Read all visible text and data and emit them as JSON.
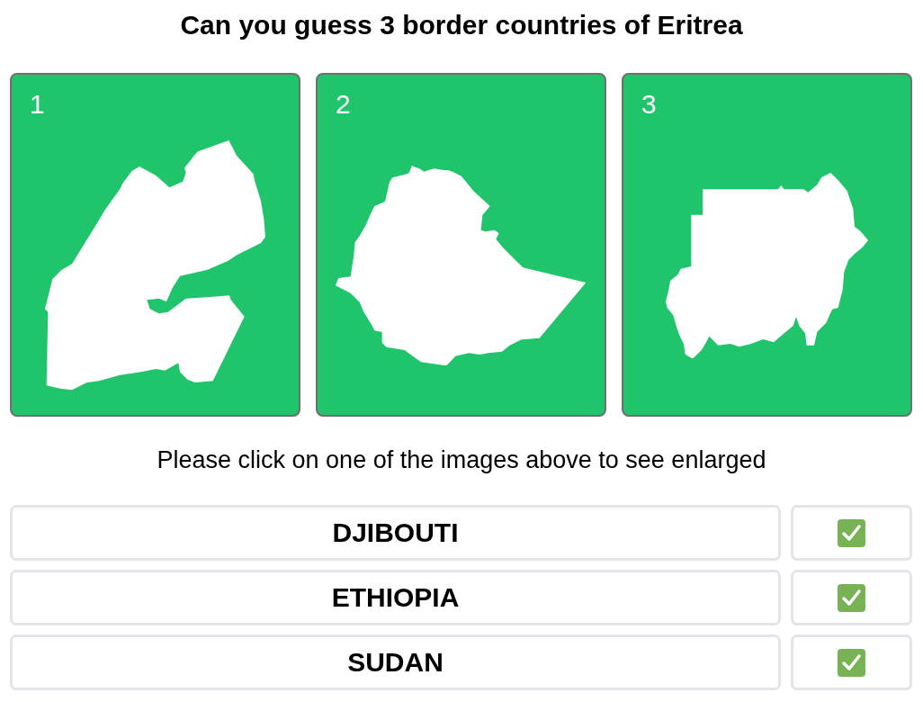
{
  "title": "Can you guess 3 border countries of Eritrea",
  "cards": [
    {
      "number": "1"
    },
    {
      "number": "2"
    },
    {
      "number": "3"
    }
  ],
  "instruction": "Please click on one of the images above to see enlarged",
  "answers": [
    {
      "name": "DJIBOUTI",
      "correct": true
    },
    {
      "name": "ETHIOPIA",
      "correct": true
    },
    {
      "name": "SUDAN",
      "correct": true
    }
  ]
}
